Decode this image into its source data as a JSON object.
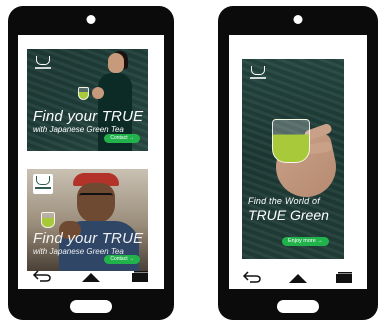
{
  "phones": {
    "left": {
      "ads": [
        {
          "headline_1": "Find your TRUE",
          "headline_2": "with Japanese Green Tea",
          "cta": "Contact →"
        },
        {
          "headline_1": "Find your TRUE",
          "headline_2": "with Japanese Green Tea",
          "cta": "Contact →"
        }
      ]
    },
    "right": {
      "ad": {
        "headline_1": "Find the World of",
        "headline_2": "TRUE Green",
        "cta": "Enjoy more →"
      }
    }
  },
  "navbar": {
    "icons": [
      "back-arrow-icon",
      "home-icon",
      "recent-apps-icon"
    ]
  },
  "colors": {
    "phone_frame": "#0b0b0b",
    "cta_green": "#22b24c",
    "ad_dark_green": "#1f3b36",
    "tea_green": "#a7c93a"
  }
}
